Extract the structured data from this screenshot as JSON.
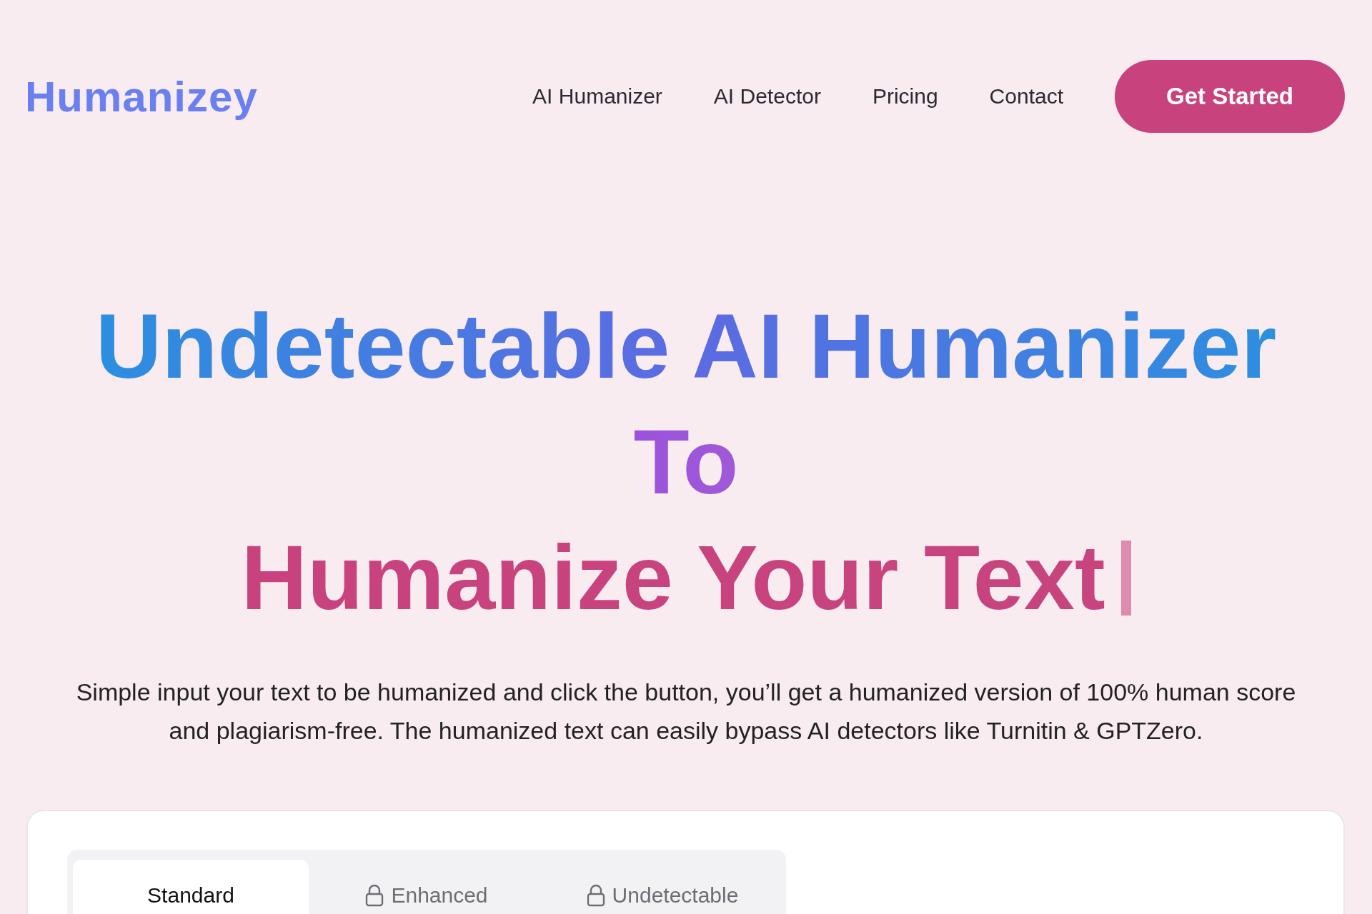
{
  "header": {
    "logo": "Humanizey",
    "nav": [
      {
        "label": "AI Humanizer"
      },
      {
        "label": "AI Detector"
      },
      {
        "label": "Pricing"
      },
      {
        "label": "Contact"
      }
    ],
    "cta": "Get Started"
  },
  "hero": {
    "lines": [
      {
        "text": "Undetectable AI Humanizer",
        "kind": "blue"
      },
      {
        "text": "To",
        "kind": "purple"
      },
      {
        "text": "Humanize Your Text",
        "kind": "pink"
      }
    ],
    "typing_cursor": true,
    "description": "Simple input your text to be humanized and click the button, you’ll get a humanized version of 100% human score and plagiarism-free. The humanized text can easily bypass AI detectors like Turnitin & GPTZero."
  },
  "modes": [
    {
      "label": "Standard",
      "selected": true,
      "locked": false
    },
    {
      "label": "Enhanced",
      "selected": false,
      "locked": true
    },
    {
      "label": "Undetectable",
      "selected": false,
      "locked": true
    }
  ]
}
